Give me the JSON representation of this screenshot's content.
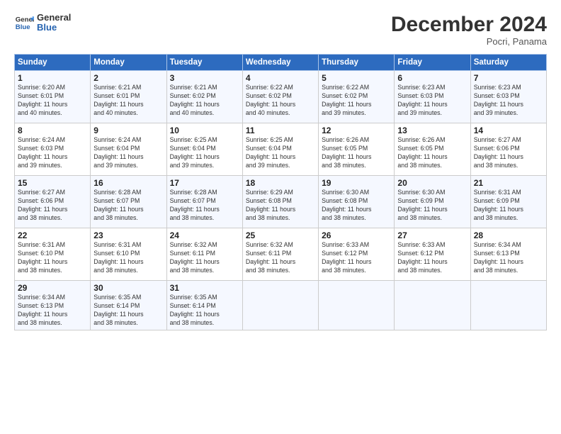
{
  "header": {
    "logo_line1": "General",
    "logo_line2": "Blue",
    "month": "December 2024",
    "location": "Pocri, Panama"
  },
  "days_of_week": [
    "Sunday",
    "Monday",
    "Tuesday",
    "Wednesday",
    "Thursday",
    "Friday",
    "Saturday"
  ],
  "weeks": [
    [
      {
        "day": "1",
        "info": "Sunrise: 6:20 AM\nSunset: 6:01 PM\nDaylight: 11 hours\nand 40 minutes."
      },
      {
        "day": "2",
        "info": "Sunrise: 6:21 AM\nSunset: 6:01 PM\nDaylight: 11 hours\nand 40 minutes."
      },
      {
        "day": "3",
        "info": "Sunrise: 6:21 AM\nSunset: 6:02 PM\nDaylight: 11 hours\nand 40 minutes."
      },
      {
        "day": "4",
        "info": "Sunrise: 6:22 AM\nSunset: 6:02 PM\nDaylight: 11 hours\nand 40 minutes."
      },
      {
        "day": "5",
        "info": "Sunrise: 6:22 AM\nSunset: 6:02 PM\nDaylight: 11 hours\nand 39 minutes."
      },
      {
        "day": "6",
        "info": "Sunrise: 6:23 AM\nSunset: 6:03 PM\nDaylight: 11 hours\nand 39 minutes."
      },
      {
        "day": "7",
        "info": "Sunrise: 6:23 AM\nSunset: 6:03 PM\nDaylight: 11 hours\nand 39 minutes."
      }
    ],
    [
      {
        "day": "8",
        "info": "Sunrise: 6:24 AM\nSunset: 6:03 PM\nDaylight: 11 hours\nand 39 minutes."
      },
      {
        "day": "9",
        "info": "Sunrise: 6:24 AM\nSunset: 6:04 PM\nDaylight: 11 hours\nand 39 minutes."
      },
      {
        "day": "10",
        "info": "Sunrise: 6:25 AM\nSunset: 6:04 PM\nDaylight: 11 hours\nand 39 minutes."
      },
      {
        "day": "11",
        "info": "Sunrise: 6:25 AM\nSunset: 6:04 PM\nDaylight: 11 hours\nand 39 minutes."
      },
      {
        "day": "12",
        "info": "Sunrise: 6:26 AM\nSunset: 6:05 PM\nDaylight: 11 hours\nand 38 minutes."
      },
      {
        "day": "13",
        "info": "Sunrise: 6:26 AM\nSunset: 6:05 PM\nDaylight: 11 hours\nand 38 minutes."
      },
      {
        "day": "14",
        "info": "Sunrise: 6:27 AM\nSunset: 6:06 PM\nDaylight: 11 hours\nand 38 minutes."
      }
    ],
    [
      {
        "day": "15",
        "info": "Sunrise: 6:27 AM\nSunset: 6:06 PM\nDaylight: 11 hours\nand 38 minutes."
      },
      {
        "day": "16",
        "info": "Sunrise: 6:28 AM\nSunset: 6:07 PM\nDaylight: 11 hours\nand 38 minutes."
      },
      {
        "day": "17",
        "info": "Sunrise: 6:28 AM\nSunset: 6:07 PM\nDaylight: 11 hours\nand 38 minutes."
      },
      {
        "day": "18",
        "info": "Sunrise: 6:29 AM\nSunset: 6:08 PM\nDaylight: 11 hours\nand 38 minutes."
      },
      {
        "day": "19",
        "info": "Sunrise: 6:30 AM\nSunset: 6:08 PM\nDaylight: 11 hours\nand 38 minutes."
      },
      {
        "day": "20",
        "info": "Sunrise: 6:30 AM\nSunset: 6:09 PM\nDaylight: 11 hours\nand 38 minutes."
      },
      {
        "day": "21",
        "info": "Sunrise: 6:31 AM\nSunset: 6:09 PM\nDaylight: 11 hours\nand 38 minutes."
      }
    ],
    [
      {
        "day": "22",
        "info": "Sunrise: 6:31 AM\nSunset: 6:10 PM\nDaylight: 11 hours\nand 38 minutes."
      },
      {
        "day": "23",
        "info": "Sunrise: 6:31 AM\nSunset: 6:10 PM\nDaylight: 11 hours\nand 38 minutes."
      },
      {
        "day": "24",
        "info": "Sunrise: 6:32 AM\nSunset: 6:11 PM\nDaylight: 11 hours\nand 38 minutes."
      },
      {
        "day": "25",
        "info": "Sunrise: 6:32 AM\nSunset: 6:11 PM\nDaylight: 11 hours\nand 38 minutes."
      },
      {
        "day": "26",
        "info": "Sunrise: 6:33 AM\nSunset: 6:12 PM\nDaylight: 11 hours\nand 38 minutes."
      },
      {
        "day": "27",
        "info": "Sunrise: 6:33 AM\nSunset: 6:12 PM\nDaylight: 11 hours\nand 38 minutes."
      },
      {
        "day": "28",
        "info": "Sunrise: 6:34 AM\nSunset: 6:13 PM\nDaylight: 11 hours\nand 38 minutes."
      }
    ],
    [
      {
        "day": "29",
        "info": "Sunrise: 6:34 AM\nSunset: 6:13 PM\nDaylight: 11 hours\nand 38 minutes."
      },
      {
        "day": "30",
        "info": "Sunrise: 6:35 AM\nSunset: 6:14 PM\nDaylight: 11 hours\nand 38 minutes."
      },
      {
        "day": "31",
        "info": "Sunrise: 6:35 AM\nSunset: 6:14 PM\nDaylight: 11 hours\nand 38 minutes."
      },
      {
        "day": "",
        "info": ""
      },
      {
        "day": "",
        "info": ""
      },
      {
        "day": "",
        "info": ""
      },
      {
        "day": "",
        "info": ""
      }
    ]
  ]
}
